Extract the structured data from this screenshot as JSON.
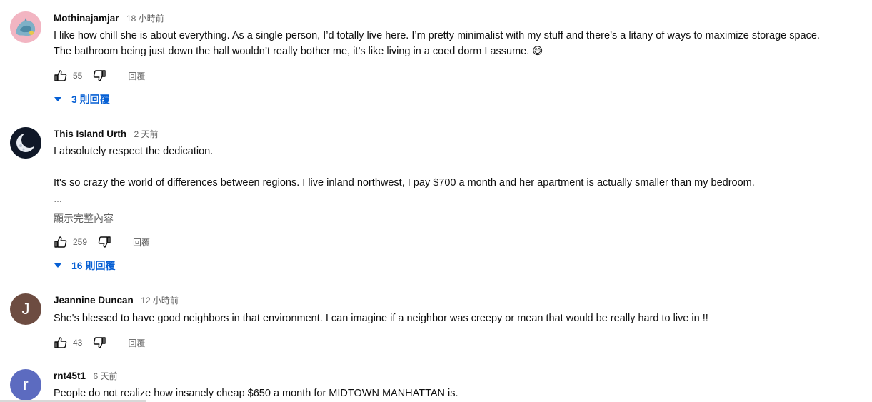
{
  "colors": {
    "text_primary": "#0f0f0f",
    "text_secondary": "#606060",
    "replies_blue": "#065fd4"
  },
  "comments": [
    {
      "author": "Mothinajamjar",
      "time": "18 小時前",
      "avatar_icon": "watercolor-avatar",
      "lines": [
        "I like how chill she is about everything. As a single person, I’d totally live here. I’m pretty minimalist with my stuff and there’s a litany of ways to maximize storage space.",
        "The bathroom being just down the hall wouldn’t really bother me, it’s like living in a coed dorm I assume. 😅"
      ],
      "likes": "55",
      "reply_label": "回覆",
      "replies_label": "3 則回覆"
    },
    {
      "author": "This Island Urth",
      "time": "2 天前",
      "avatar_icon": "moon-avatar",
      "lines": [
        "I absolutely respect the dedication.",
        "It's so crazy the world of differences between regions. I live inland northwest, I pay $700 a month and her apartment is actually smaller than my bedroom."
      ],
      "ellipsis": "…",
      "show_more": "顯示完整內容",
      "likes": "259",
      "reply_label": "回覆",
      "replies_label": "16 則回覆"
    },
    {
      "author": "Jeannine Duncan",
      "time": "12 小時前",
      "avatar_letter": "J",
      "avatar_color": "#6d4c41",
      "lines": [
        "She's blessed to have good neighbors in that environment. I can imagine if a neighbor was creepy or mean that would be really hard to live in !!"
      ],
      "likes": "43",
      "reply_label": "回覆"
    },
    {
      "author": "rnt45t1",
      "time": "6 天前",
      "avatar_letter": "r",
      "avatar_color": "#5c6bc0",
      "lines": [
        "People do not realize how insanely cheap $650 a month for MIDTOWN MANHATTAN is."
      ]
    }
  ]
}
